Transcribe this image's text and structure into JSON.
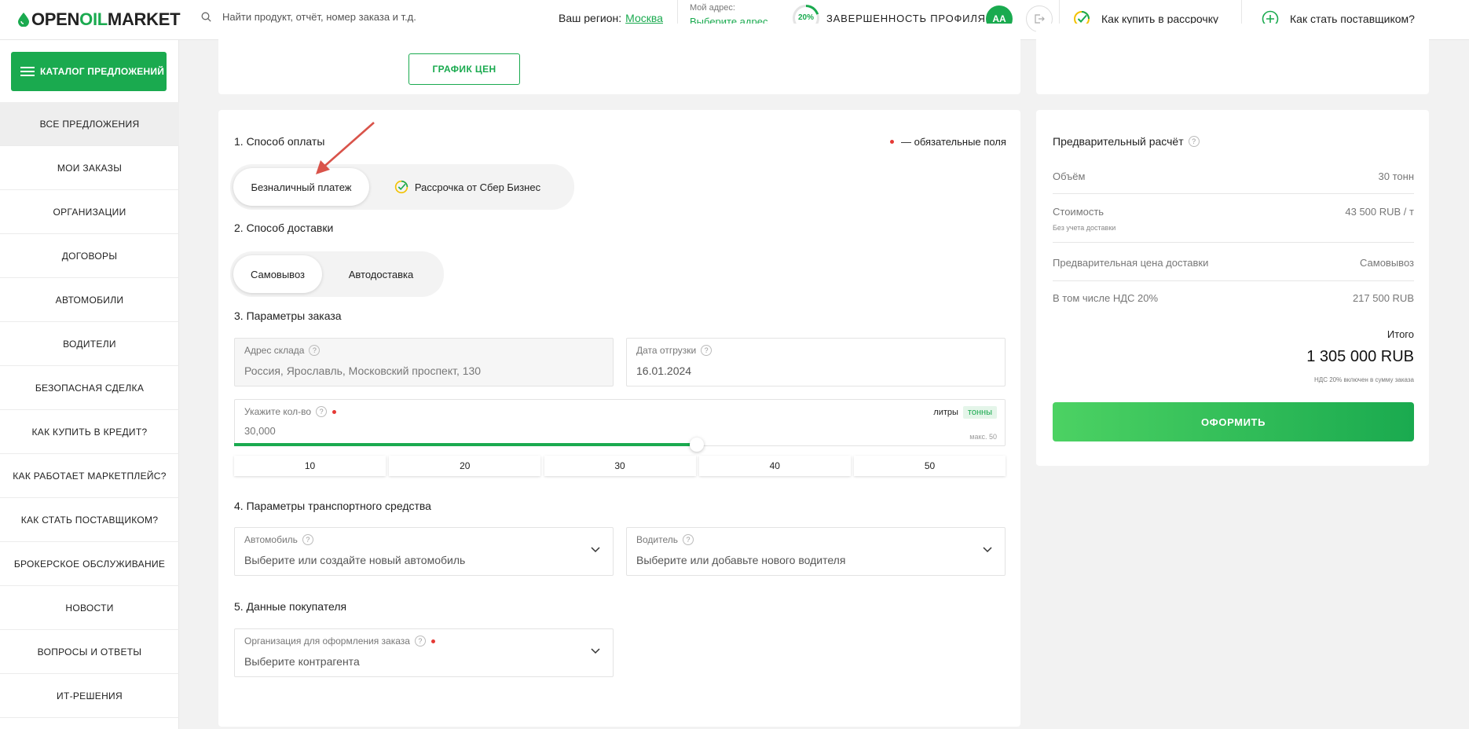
{
  "header": {
    "logo": {
      "open": "OPEN",
      "oil": "OIL",
      "market": "MARKET"
    },
    "search_placeholder": "Найти продукт, отчёт, номер заказа и т.д.",
    "region_label": "Ваш регион:",
    "region_value": "Москва",
    "address_caption": "Мой адрес:",
    "address_link": "Выберите адрес",
    "profile_percent": "20%",
    "profile_progress": 0.2,
    "profile_label": "ЗАВЕРШЕННОСТЬ ПРОФИЛЯ",
    "avatar_initials": "АА",
    "installment_link": "Как купить в рассрочку",
    "supplier_link": "Как стать поставщиком?"
  },
  "sidebar": {
    "catalog_button": "КАТАЛОГ ПРЕДЛОЖЕНИЙ",
    "items": [
      "ВСЕ ПРЕДЛОЖЕНИЯ",
      "МОИ ЗАКАЗЫ",
      "ОРГАНИЗАЦИИ",
      "ДОГОВОРЫ",
      "АВТОМОБИЛИ",
      "ВОДИТЕЛИ",
      "БЕЗОПАСНАЯ СДЕЛКА",
      "КАК КУПИТЬ В КРЕДИТ?",
      "КАК РАБОТАЕТ МАРКЕТПЛЕЙС?",
      "КАК СТАТЬ ПОСТАВЩИКОМ?",
      "БРОКЕРСКОЕ ОБСЛУЖИВАНИЕ",
      "НОВОСТИ",
      "ВОПРОСЫ И ОТВЕТЫ",
      "ИТ-РЕШЕНИЯ"
    ]
  },
  "top_card": {
    "price_chart_button": "ГРАФИК ЦЕН"
  },
  "order": {
    "required_note": "— обязательные поля",
    "payment": {
      "title": "1. Способ оплаты",
      "options": [
        "Безналичный платеж",
        "Рассрочка от Сбер Бизнес"
      ],
      "selected": 0
    },
    "delivery": {
      "title": "2. Способ доставки",
      "options": [
        "Самовывоз",
        "Автодоставка"
      ],
      "selected": 0
    },
    "params": {
      "title": "3. Параметры заказа",
      "warehouse_label": "Адрес склада",
      "warehouse_value": "Россия, Ярославль, Московский проспект, 130",
      "date_label": "Дата отгрузки",
      "date_value": "16.01.2024",
      "qty_label": "Укажите кол-во",
      "qty_value": "30,000",
      "unit_liters": "литры",
      "unit_tons": "тонны",
      "max_label": "макс. 50",
      "slider_value": 30,
      "slider_max": 50,
      "ticks": [
        "10",
        "20",
        "30",
        "40",
        "50"
      ]
    },
    "vehicle": {
      "title": "4. Параметры транспортного средства",
      "car_label": "Автомобиль",
      "car_placeholder": "Выберите или создайте новый автомобиль",
      "driver_label": "Водитель",
      "driver_placeholder": "Выберите или добавьте нового водителя"
    },
    "buyer": {
      "title": "5. Данные покупателя",
      "org_label": "Организация для оформления заказа",
      "org_placeholder": "Выберите контрагента"
    }
  },
  "summary": {
    "title": "Предварительный расчёт",
    "volume_label": "Объём",
    "volume_value": "30 тонн",
    "cost_label": "Стоимость",
    "cost_sub": "Без учета доставки",
    "cost_value": "43 500 RUB / т",
    "delivery_label": "Предварительная цена доставки",
    "delivery_value": "Самовывоз",
    "vat_label": "В том числе НДС 20%",
    "vat_value": "217 500 RUB",
    "total_label": "Итого",
    "total_value": "1 305 000 RUB",
    "total_note": "НДС 20% включен в сумму заказа",
    "submit_button": "ОФОРМИТЬ"
  },
  "colors": {
    "accent": "#1aaa4f",
    "required_dot": "#e53935",
    "annotation_arrow": "#d9534a"
  }
}
